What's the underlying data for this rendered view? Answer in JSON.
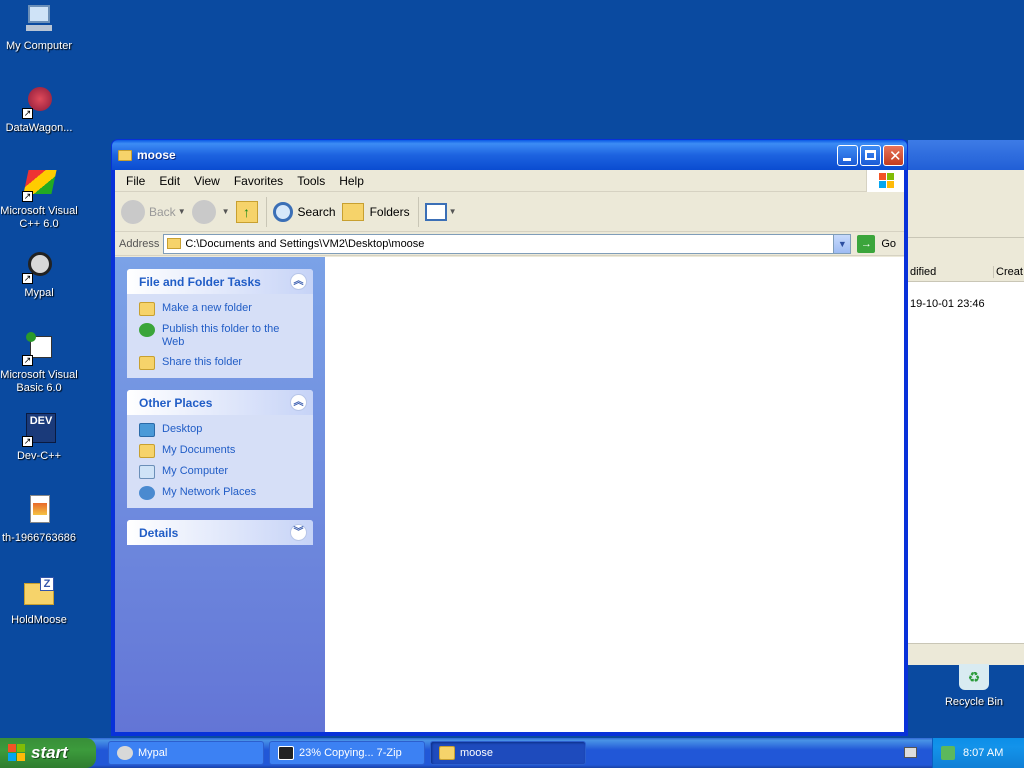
{
  "desktop": {
    "icons": [
      {
        "label": "My Computer"
      },
      {
        "label": "DataWagon..."
      },
      {
        "label": "Microsoft Visual C++ 6.0"
      },
      {
        "label": "Mypal"
      },
      {
        "label": "Microsoft Visual Basic 6.0"
      },
      {
        "label": "Dev-C++"
      },
      {
        "label": "th-1966763686"
      },
      {
        "label": "HoldMoose"
      }
    ],
    "recycle_bin": "Recycle Bin"
  },
  "background_window": {
    "col_modified": "dified",
    "col_created": "Creat",
    "row_date": "19-10-01 23:46"
  },
  "window": {
    "title": "moose",
    "menu": [
      "File",
      "Edit",
      "View",
      "Favorites",
      "Tools",
      "Help"
    ],
    "toolbar": {
      "back": "Back",
      "search": "Search",
      "folders": "Folders"
    },
    "address": {
      "label": "Address",
      "value": "C:\\Documents and Settings\\VM2\\Desktop\\moose",
      "go": "Go"
    },
    "tasks": {
      "file_folder": {
        "title": "File and Folder Tasks",
        "items": [
          "Make a new folder",
          "Publish this folder to the Web",
          "Share this folder"
        ]
      },
      "other_places": {
        "title": "Other Places",
        "items": [
          "Desktop",
          "My Documents",
          "My Computer",
          "My Network Places"
        ]
      },
      "details": {
        "title": "Details"
      }
    }
  },
  "taskbar": {
    "start": "start",
    "tasks": [
      "Mypal",
      "23% Copying... 7-Zip",
      "moose"
    ],
    "clock": "8:07 AM"
  }
}
